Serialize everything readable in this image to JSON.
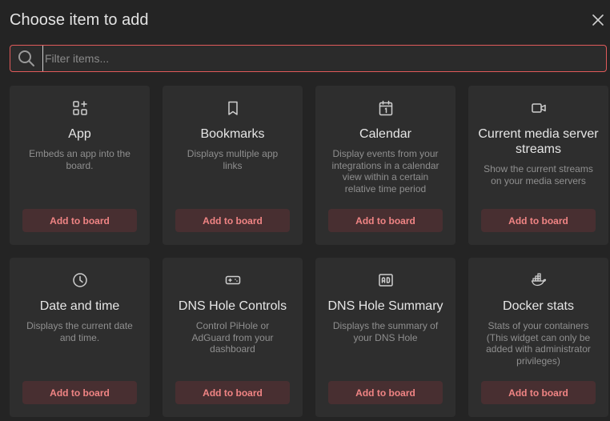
{
  "modal": {
    "title": "Choose item to add",
    "close_icon": "close-icon"
  },
  "search": {
    "placeholder": "Filter items...",
    "value": "",
    "icon": "search-icon"
  },
  "items": [
    {
      "icon": "widget-add-icon",
      "title": "App",
      "description": "Embeds an app into the board.",
      "button": "Add to board"
    },
    {
      "icon": "bookmark-icon",
      "title": "Bookmarks",
      "description": "Displays multiple app links",
      "button": "Add to board"
    },
    {
      "icon": "calendar-icon",
      "title": "Calendar",
      "description": "Display events from your integrations in a calendar view within a certain relative time period",
      "button": "Add to board"
    },
    {
      "icon": "video-camera-icon",
      "title": "Current media server streams",
      "description": "Show the current streams on your media servers",
      "button": "Add to board"
    },
    {
      "icon": "clock-icon",
      "title": "Date and time",
      "description": "Displays the current date and time.",
      "button": "Add to board"
    },
    {
      "icon": "gamepad-icon",
      "title": "DNS Hole Controls",
      "description": "Control PiHole or AdGuard from your dashboard",
      "button": "Add to board"
    },
    {
      "icon": "ad-icon",
      "title": "DNS Hole Summary",
      "description": "Displays the summary of your DNS Hole",
      "button": "Add to board"
    },
    {
      "icon": "docker-icon",
      "title": "Docker stats",
      "description": "Stats of your containers (This widget can only be added with administrator privileges)",
      "button": "Add to board"
    }
  ],
  "colors": {
    "accent": "#e05a5a",
    "button_bg": "#482f31",
    "button_text": "#f08484",
    "card_bg": "#2e2e2e",
    "page_bg": "#242424"
  }
}
